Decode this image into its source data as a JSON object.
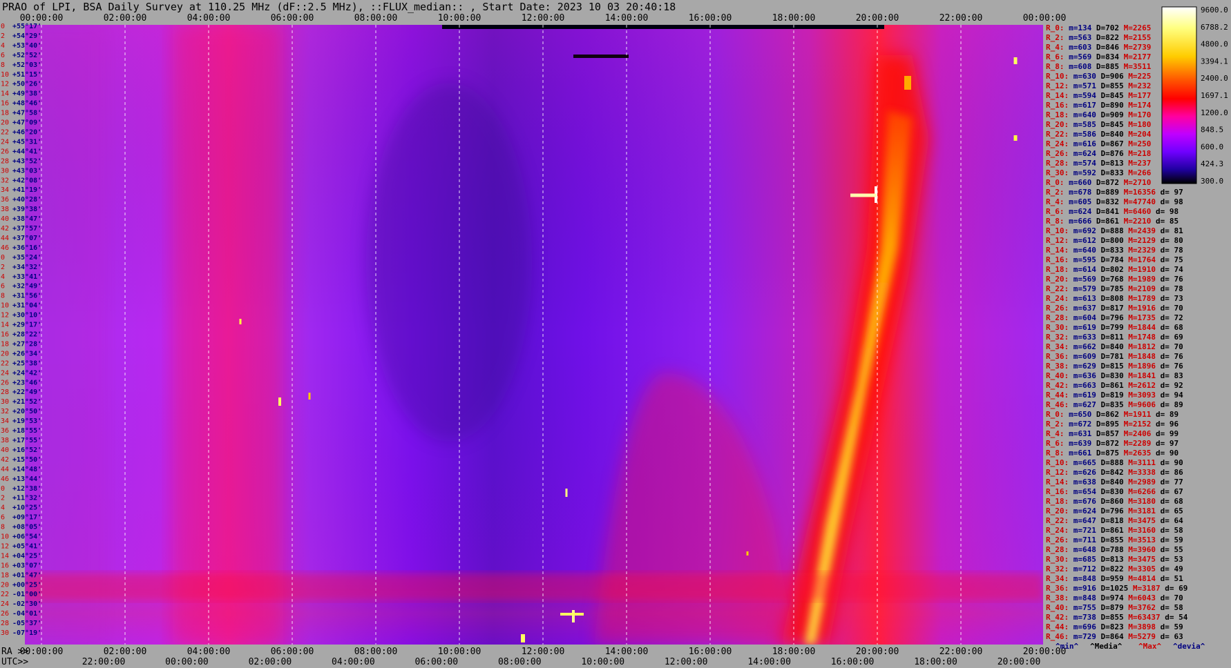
{
  "title": "PRAO of LPI, BSA Daily Survey at 110.25 MHz (dF::2.5 MHz), ::FLUX_median:: , Start Date: 2023 10 03 20:40:18",
  "colors": {
    "background": "#a8a8a8",
    "heatmap_low": "#7a00f0",
    "heatmap_mid": "#ff0000",
    "heatmap_high": "#ffffa0",
    "label_red": "#cc0000",
    "label_blue": "#000080"
  },
  "chart_data": {
    "type": "heatmap",
    "title": "PRAO of LPI, BSA Daily Survey at 110.25 MHz (dF::2.5 MHz), ::FLUX_median:: , Start Date: 2023 10 03 20:40:18",
    "x_top_ticks": [
      "00:00:00",
      "02:00:00",
      "04:00:00",
      "06:00:00",
      "08:00:00",
      "10:00:00",
      "12:00:00",
      "14:00:00",
      "16:00:00",
      "18:00:00",
      "20:00:00",
      "22:00:00",
      "00:00:00"
    ],
    "x_bottom_ra_label": "RA >>",
    "x_bottom_ra_ticks": [
      "00:00:00",
      "02:00:00",
      "04:00:00",
      "06:00:00",
      "08:00:00",
      "10:00:00",
      "12:00:00",
      "14:00:00",
      "16:00:00",
      "18:00:00",
      "20:00:00",
      "22:00:00",
      "20:00:00"
    ],
    "x_bottom_utc_label": "UTC>>",
    "x_bottom_utc_ticks": [
      "22:00:00",
      "00:00:00",
      "02:00:00",
      "04:00:00",
      "06:00:00",
      "08:00:00",
      "10:00:00",
      "12:00:00",
      "14:00:00",
      "16:00:00",
      "18:00:00",
      "20:00:00"
    ],
    "y_declinations": [
      "+55°17'",
      "+54°29'",
      "+53°40'",
      "+52°52'",
      "+52°03'",
      "+51°15'",
      "+50°26'",
      "+49°38'",
      "+48°46'",
      "+47°58'",
      "+47°09'",
      "+46°20'",
      "+45°31'",
      "+44°41'",
      "+43°52'",
      "+43°03'",
      "+42°08'",
      "+41°19'",
      "+40°28'",
      "+39°38'",
      "+38°47'",
      "+37°57'",
      "+37°07'",
      "+36°16'",
      "+35°24'",
      "+34°32'",
      "+33°41'",
      "+32°49'",
      "+31°56'",
      "+31°04'",
      "+30°10'",
      "+29°17'",
      "+28°22'",
      "+27°28'",
      "+26°34'",
      "+25°38'",
      "+24°42'",
      "+23°46'",
      "+22°49'",
      "+21°52'",
      "+20°50'",
      "+19°53'",
      "+18°55'",
      "+17°55'",
      "+16°52'",
      "+15°50'",
      "+14°48'",
      "+13°44'",
      "+12°38'",
      "+11°32'",
      "+10°25'",
      "+09°17'",
      "+08°05'",
      "+06°54'",
      "+05°41'",
      "+04°25'",
      "+03°07'",
      "+01°47'",
      "+00°25'",
      "-01°00'",
      "-02°30'",
      "-04°01'",
      "-05°37'",
      "-07°19'"
    ],
    "colorbar": {
      "ticks": [
        "9600.0",
        "6788.2",
        "4800.0",
        "3394.1",
        "2400.0",
        "1697.1",
        "1200.0",
        "848.5",
        "600.0",
        "424.3",
        "300.0"
      ],
      "scale": "log"
    },
    "rows": [
      {
        "r": "R_0:",
        "m": "134",
        "D": "702",
        "M": "2265",
        "d": ""
      },
      {
        "r": "R_2:",
        "m": "563",
        "D": "822",
        "M": "2155",
        "d": ""
      },
      {
        "r": "R_4:",
        "m": "603",
        "D": "846",
        "M": "2739",
        "d": ""
      },
      {
        "r": "R_6:",
        "m": "569",
        "D": "834",
        "M": "2177",
        "d": ""
      },
      {
        "r": "R_8:",
        "m": "608",
        "D": "885",
        "M": "3511",
        "d": ""
      },
      {
        "r": "R_10:",
        "m": "630",
        "D": "906",
        "M": "225",
        "d": ""
      },
      {
        "r": "R_12:",
        "m": "571",
        "D": "855",
        "M": "232",
        "d": ""
      },
      {
        "r": "R_14:",
        "m": "594",
        "D": "845",
        "M": "177",
        "d": ""
      },
      {
        "r": "R_16:",
        "m": "617",
        "D": "890",
        "M": "174",
        "d": ""
      },
      {
        "r": "R_18:",
        "m": "640",
        "D": "909",
        "M": "170",
        "d": ""
      },
      {
        "r": "R_20:",
        "m": "585",
        "D": "845",
        "M": "180",
        "d": ""
      },
      {
        "r": "R_22:",
        "m": "586",
        "D": "840",
        "M": "204",
        "d": ""
      },
      {
        "r": "R_24:",
        "m": "616",
        "D": "867",
        "M": "250",
        "d": ""
      },
      {
        "r": "R_26:",
        "m": "624",
        "D": "876",
        "M": "218",
        "d": ""
      },
      {
        "r": "R_28:",
        "m": "574",
        "D": "813",
        "M": "237",
        "d": ""
      },
      {
        "r": "R_30:",
        "m": "592",
        "D": "833",
        "M": "266",
        "d": ""
      },
      {
        "r": "R_0:",
        "m": "660",
        "D": "872",
        "M": "2710",
        "d": ""
      },
      {
        "r": "R_2:",
        "m": "678",
        "D": "889",
        "M": "16356",
        "d": "97"
      },
      {
        "r": "R_4:",
        "m": "605",
        "D": "832",
        "M": "47740",
        "d": "98"
      },
      {
        "r": "R_6:",
        "m": "624",
        "D": "841",
        "M": "6460",
        "d": "98"
      },
      {
        "r": "R_8:",
        "m": "666",
        "D": "861",
        "M": "2210",
        "d": "85"
      },
      {
        "r": "R_10:",
        "m": "692",
        "D": "888",
        "M": "2439",
        "d": "81"
      },
      {
        "r": "R_12:",
        "m": "612",
        "D": "800",
        "M": "2129",
        "d": "80"
      },
      {
        "r": "R_14:",
        "m": "640",
        "D": "833",
        "M": "2329",
        "d": "78"
      },
      {
        "r": "R_16:",
        "m": "595",
        "D": "784",
        "M": "1764",
        "d": "75"
      },
      {
        "r": "R_18:",
        "m": "614",
        "D": "802",
        "M": "1910",
        "d": "74"
      },
      {
        "r": "R_20:",
        "m": "569",
        "D": "768",
        "M": "1989",
        "d": "76"
      },
      {
        "r": "R_22:",
        "m": "579",
        "D": "785",
        "M": "2109",
        "d": "78"
      },
      {
        "r": "R_24:",
        "m": "613",
        "D": "808",
        "M": "1789",
        "d": "73"
      },
      {
        "r": "R_26:",
        "m": "637",
        "D": "817",
        "M": "1916",
        "d": "70"
      },
      {
        "r": "R_28:",
        "m": "604",
        "D": "796",
        "M": "1735",
        "d": "72"
      },
      {
        "r": "R_30:",
        "m": "619",
        "D": "799",
        "M": "1844",
        "d": "68"
      },
      {
        "r": "R_32:",
        "m": "633",
        "D": "811",
        "M": "1748",
        "d": "69"
      },
      {
        "r": "R_34:",
        "m": "662",
        "D": "840",
        "M": "1812",
        "d": "70"
      },
      {
        "r": "R_36:",
        "m": "609",
        "D": "781",
        "M": "1848",
        "d": "76"
      },
      {
        "r": "R_38:",
        "m": "629",
        "D": "815",
        "M": "1896",
        "d": "76"
      },
      {
        "r": "R_40:",
        "m": "636",
        "D": "830",
        "M": "1841",
        "d": "83"
      },
      {
        "r": "R_42:",
        "m": "663",
        "D": "861",
        "M": "2612",
        "d": "92"
      },
      {
        "r": "R_44:",
        "m": "619",
        "D": "819",
        "M": "3093",
        "d": "94"
      },
      {
        "r": "R_46:",
        "m": "627",
        "D": "835",
        "M": "9606",
        "d": "89"
      },
      {
        "r": "R_0:",
        "m": "650",
        "D": "862",
        "M": "1911",
        "d": "89"
      },
      {
        "r": "R_2:",
        "m": "672",
        "D": "895",
        "M": "2152",
        "d": "96"
      },
      {
        "r": "R_4:",
        "m": "631",
        "D": "857",
        "M": "2406",
        "d": "99"
      },
      {
        "r": "R_6:",
        "m": "639",
        "D": "872",
        "M": "2289",
        "d": "97"
      },
      {
        "r": "R_8:",
        "m": "661",
        "D": "875",
        "M": "2635",
        "d": "90"
      },
      {
        "r": "R_10:",
        "m": "665",
        "D": "888",
        "M": "3111",
        "d": "90"
      },
      {
        "r": "R_12:",
        "m": "626",
        "D": "842",
        "M": "3338",
        "d": "86"
      },
      {
        "r": "R_14:",
        "m": "638",
        "D": "840",
        "M": "2989",
        "d": "77"
      },
      {
        "r": "R_16:",
        "m": "654",
        "D": "830",
        "M": "6266",
        "d": "67"
      },
      {
        "r": "R_18:",
        "m": "676",
        "D": "860",
        "M": "3180",
        "d": "68"
      },
      {
        "r": "R_20:",
        "m": "624",
        "D": "796",
        "M": "3181",
        "d": "65"
      },
      {
        "r": "R_22:",
        "m": "647",
        "D": "818",
        "M": "3475",
        "d": "64"
      },
      {
        "r": "R_24:",
        "m": "721",
        "D": "861",
        "M": "3160",
        "d": "58"
      },
      {
        "r": "R_26:",
        "m": "711",
        "D": "855",
        "M": "3513",
        "d": "59"
      },
      {
        "r": "R_28:",
        "m": "648",
        "D": "788",
        "M": "3960",
        "d": "55"
      },
      {
        "r": "R_30:",
        "m": "685",
        "D": "813",
        "M": "3475",
        "d": "53"
      },
      {
        "r": "R_32:",
        "m": "712",
        "D": "822",
        "M": "3305",
        "d": "49"
      },
      {
        "r": "R_34:",
        "m": "848",
        "D": "959",
        "M": "4814",
        "d": "51"
      },
      {
        "r": "R_36:",
        "m": "916",
        "D": "1025",
        "M": "3187",
        "d": "69"
      },
      {
        "r": "R_38:",
        "m": "848",
        "D": "974",
        "M": "6043",
        "d": "70"
      },
      {
        "r": "R_40:",
        "m": "755",
        "D": "879",
        "M": "3762",
        "d": "58"
      },
      {
        "r": "R_42:",
        "m": "738",
        "D": "855",
        "M": "63437",
        "d": "54"
      },
      {
        "r": "R_44:",
        "m": "696",
        "D": "823",
        "M": "3898",
        "d": "59"
      },
      {
        "r": "R_46:",
        "m": "729",
        "D": "864",
        "M": "5279",
        "d": "63"
      }
    ],
    "bottom_legend": [
      "^min^",
      "^Media^",
      "^Max^",
      "^devia^"
    ]
  }
}
